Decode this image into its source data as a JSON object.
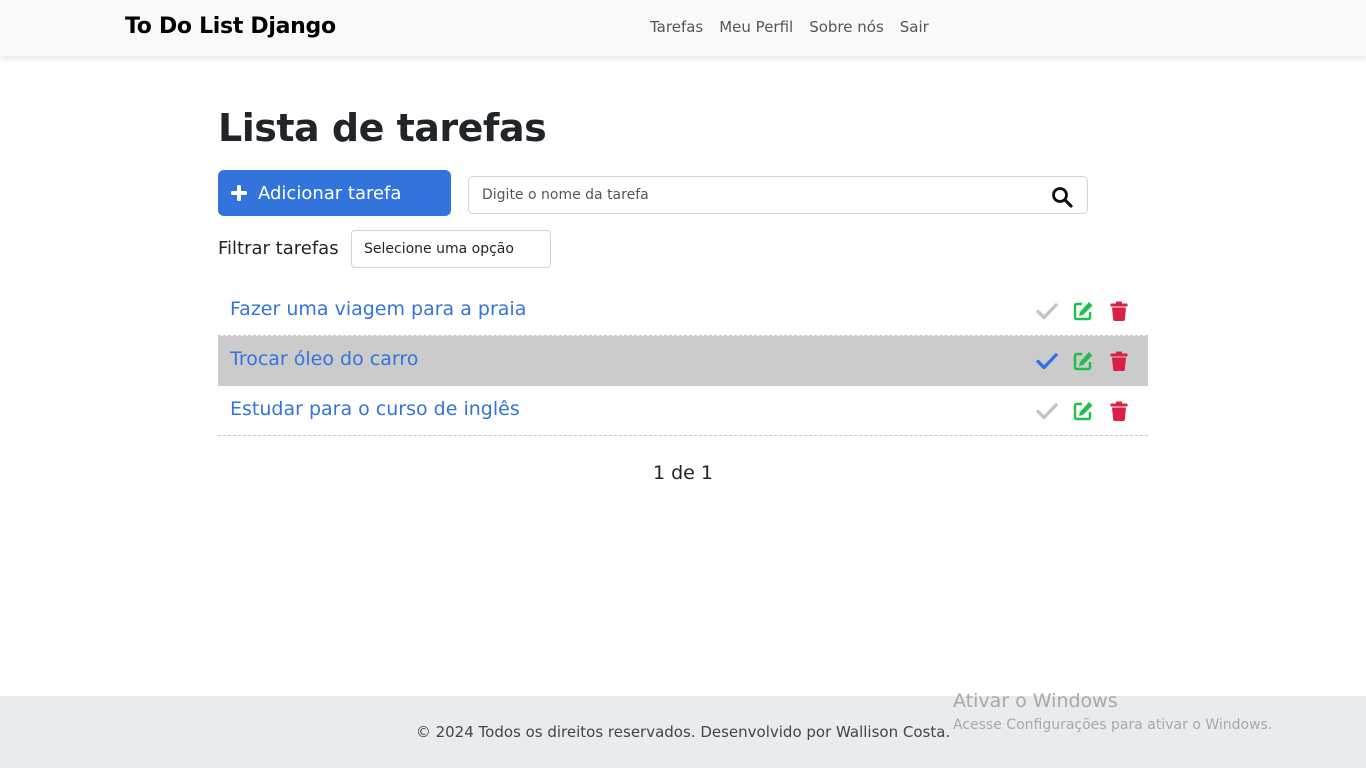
{
  "navbar": {
    "brand": "To Do List Django",
    "links": [
      "Tarefas",
      "Meu Perfil",
      "Sobre nós",
      "Sair"
    ]
  },
  "main": {
    "title": "Lista de tarefas",
    "add_button_label": "Adicionar tarefa",
    "search_placeholder": "Digite o nome da tarefa",
    "filter_label": "Filtrar tarefas",
    "filter_selected": "Selecione uma opção"
  },
  "tasks": [
    {
      "title": "Fazer uma viagem para a praia",
      "done": false
    },
    {
      "title": "Trocar óleo do carro",
      "done": true
    },
    {
      "title": "Estudar para o curso de inglês",
      "done": false
    }
  ],
  "pagination": "1 de 1",
  "footer": "© 2024 Todos os direitos reservados. Desenvolvido por Wallison Costa.",
  "watermark": {
    "title": "Ativar o Windows",
    "subtitle": "Acesse Configurações para ativar o Windows."
  },
  "icons": {
    "plus": "plus-icon",
    "search": "search-icon",
    "check": "check-icon",
    "edit": "edit-icon",
    "trash": "trash-icon"
  },
  "colors": {
    "primary": "#3273dc",
    "check_done": "#3273dc",
    "check_pending": "#c4c4c4",
    "edit": "#1fbf4a",
    "delete": "#dc2045",
    "done_row_bg": "#cbcbcb"
  }
}
